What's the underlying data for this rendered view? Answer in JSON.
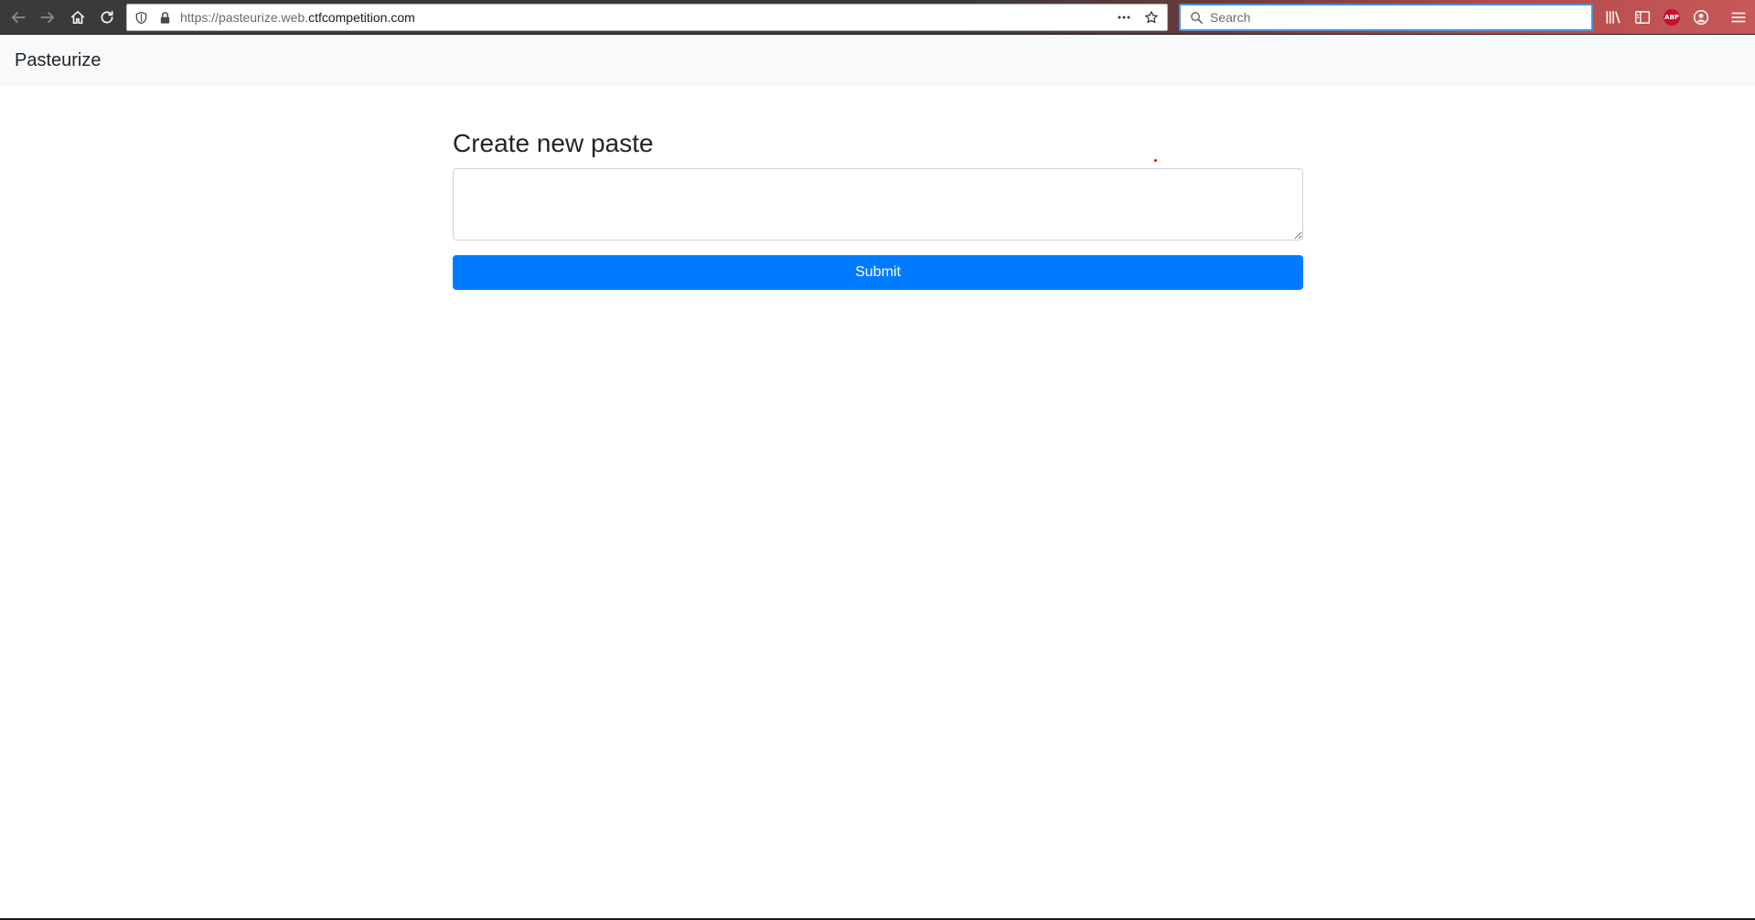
{
  "browser": {
    "url_prefix": "https://pasteurize.web.",
    "url_domain": "ctfcompetition.com",
    "search_placeholder": "Search",
    "abp_label": "ABP"
  },
  "navbar": {
    "brand": "Pasteurize"
  },
  "main": {
    "title": "Create new paste",
    "textarea_value": "",
    "submit_label": "Submit"
  },
  "colors": {
    "primary": "#007bff",
    "navbar_bg": "#f8f9fa"
  }
}
